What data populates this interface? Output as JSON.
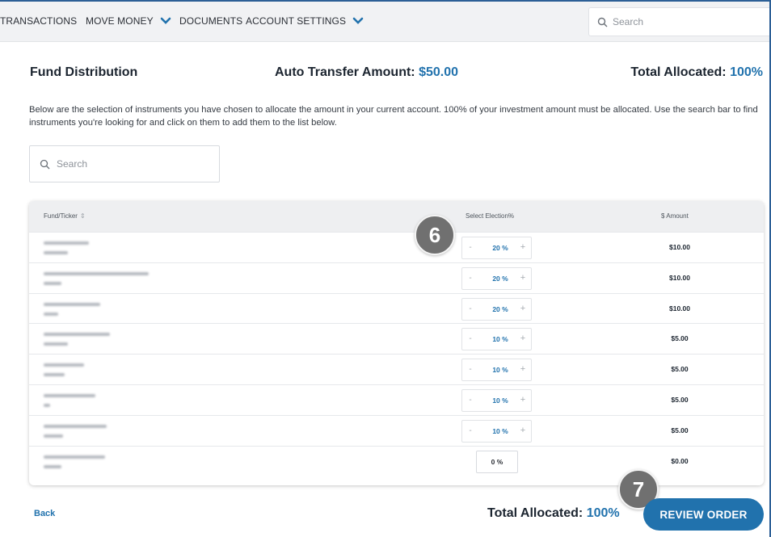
{
  "nav": {
    "items": [
      {
        "label": "TRANSACTIONS"
      },
      {
        "label": "MOVE MONEY"
      },
      {
        "label": "DOCUMENTS"
      },
      {
        "label": "ACCOUNT SETTINGS"
      }
    ],
    "search_placeholder": "Search"
  },
  "header": {
    "title": "Fund Distribution",
    "auto_transfer_label": "Auto Transfer Amount:",
    "auto_transfer_value": "$50.00",
    "total_label": "Total Allocated:",
    "total_value": "100%"
  },
  "description": "Below are the selection of instruments you have chosen to allocate the amount in your current account. 100% of your investment amount must be allocated. Use the search bar to find instruments you're looking for and click on them to add them to the list below.",
  "search": {
    "placeholder": "Search"
  },
  "table": {
    "columns": [
      "Fund/Ticker",
      "Select Election%",
      "$ Amount"
    ],
    "rows": [
      {
        "election": "20 %",
        "amount": "$10.00",
        "stepper": true
      },
      {
        "election": "20 %",
        "amount": "$10.00",
        "stepper": true
      },
      {
        "election": "20 %",
        "amount": "$10.00",
        "stepper": true
      },
      {
        "election": "10 %",
        "amount": "$5.00",
        "stepper": true
      },
      {
        "election": "10 %",
        "amount": "$5.00",
        "stepper": true
      },
      {
        "election": "10 %",
        "amount": "$5.00",
        "stepper": true
      },
      {
        "election": "10 %",
        "amount": "$5.00",
        "stepper": true
      },
      {
        "election": "0 %",
        "amount": "$0.00",
        "stepper": false
      }
    ],
    "stepper_minus": "-",
    "stepper_plus": "+"
  },
  "badges": {
    "step6": "6",
    "step7": "7"
  },
  "footer": {
    "back_label": "Back",
    "total_label": "Total Allocated:",
    "total_value": "100%",
    "review_label": "REVIEW ORDER"
  },
  "colors": {
    "accent": "#2172ad",
    "badge": "#707070"
  }
}
